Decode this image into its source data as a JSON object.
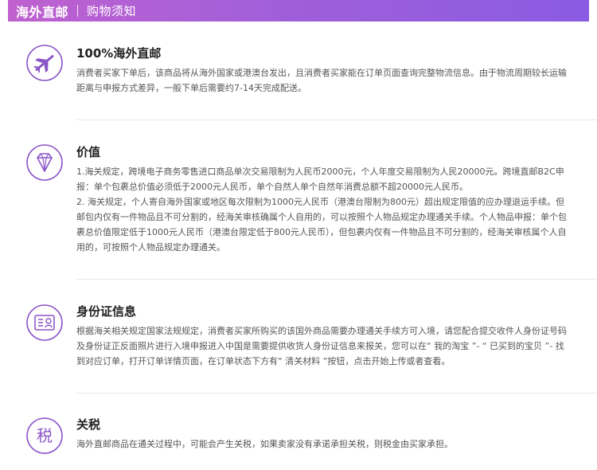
{
  "header": {
    "title": "海外直邮",
    "subtitle": "购物须知"
  },
  "colors": {
    "accent": "#9b5de5",
    "icon_stroke": "#8a56c8"
  },
  "sections": [
    {
      "icon": "airplane-icon",
      "title": "100%海外直邮",
      "paragraphs": [
        "消费者买家下单后，该商品将从海外国家或港澳台发出，且消费者买家能在订单页面查询完整物流信息。由于物流周期较长运输距离与申报方式差异，一般下单后需要约7-14天完成配送。"
      ]
    },
    {
      "icon": "diamond-icon",
      "title": "价值",
      "paragraphs": [
        "1.海关规定，跨境电子商务零售进口商品单次交易限制为人民币2000元，个人年度交易限制为人民20000元。跨境直邮B2C申报：单个包裹总价值必须低于2000元人民币，单个自然人单个自然年消费总额不超20000元人民币。",
        "2. 海关规定，个人寄自海外国家或地区每次限制为1000元人民币（港澳台限制为800元）超出规定限值的应办理退运手续。但邮包内仅有一件物品且不可分割的，经海关审核确属个人自用的，可以按照个人物品规定办理通关手续。个人物品申报：单个包裹总价值限定低于1000元人民币（港澳台限定低于800元人民币），但包裹内仅有一件物品且不可分割的，经海关审核属个人自用的，可按照个人物品规定办理通关。"
      ]
    },
    {
      "icon": "id-card-icon",
      "title": "身份证信息",
      "paragraphs": [
        "根据海关相关规定国家法规规定，消费者买家所购买的该国外商品需要办理通关手续方可入境，请您配合提交收件人身份证号码及身份证正反面照片进行入境申报进入中国是需要提供收货人身份证信息来报关，您可以在“ 我的淘宝 ”- “ 已买到的宝贝 ”- 找到对应订单，打开订单详情页面，在订单状态下方有“ 清关材料 ”按钮，点击开始上传或者查看。"
      ]
    },
    {
      "icon": "tax-icon",
      "icon_char": "税",
      "title": "关税",
      "paragraphs": [
        "海外直邮商品在通关过程中，可能会产生关税，如果卖家没有承诺承担关税，则税金由买家承担。"
      ]
    }
  ]
}
